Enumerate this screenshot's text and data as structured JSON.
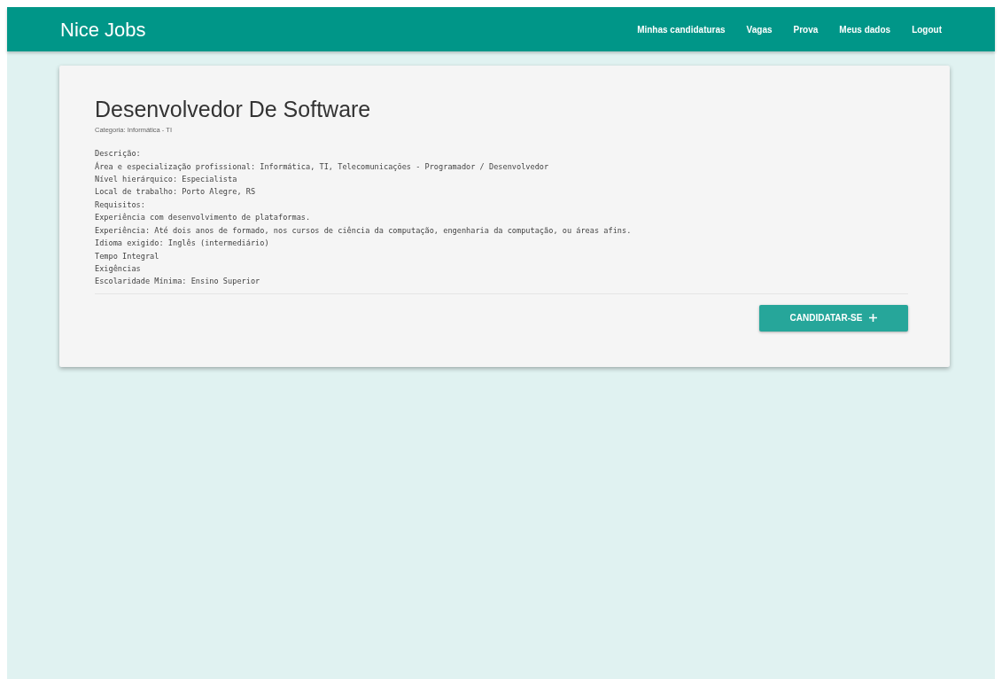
{
  "navbar": {
    "brand": "Nice Jobs",
    "links": [
      "Minhas candidaturas",
      "Vagas",
      "Prova",
      "Meus dados",
      "Logout"
    ]
  },
  "job": {
    "title": "Desenvolvedor De Software",
    "category": "Categoria: Informática - TI",
    "description_lines": [
      "Descrição:",
      "Área e especialização profissional: Informática, TI, Telecomunicações - Programador / Desenvolvedor",
      "Nível hierárquico: Especialista",
      "Local de trabalho: Porto Alegre, RS",
      "Requisitos:",
      "Experiência com desenvolvimento de plataformas.",
      "Experiência: Até dois anos de formado, nos cursos de ciência da computação, engenharia da computação, ou áreas afins.",
      "Idioma exigido: Inglês (intermediário)",
      "Tempo Integral",
      "Exigências",
      "Escolaridade Mínima: Ensino Superior"
    ],
    "apply_button": "CANDIDATAR-SE"
  }
}
